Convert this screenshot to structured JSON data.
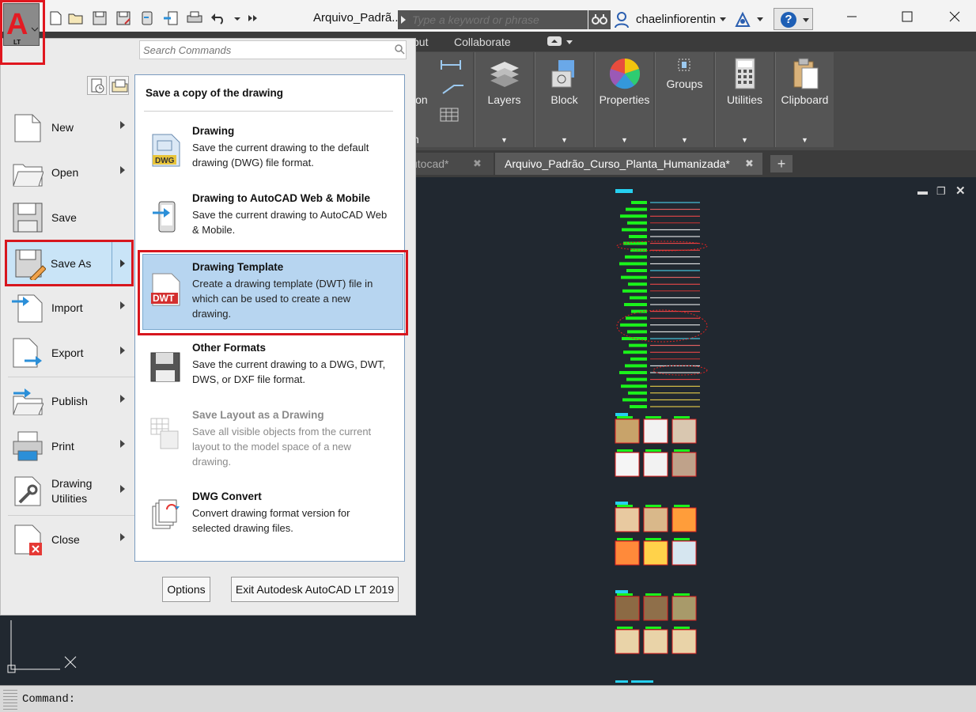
{
  "window": {
    "title": "Arquivo_Padrã...",
    "search_placeholder": "Type a keyword or phrase",
    "user": "chaelinfiorentin",
    "help": "?"
  },
  "app_button": {
    "label": "LT"
  },
  "ribbon": {
    "tabs": [
      "put",
      "Collaborate"
    ],
    "panels": [
      "Layers",
      "Block",
      "Properties",
      "Groups",
      "Utilities",
      "Clipboard"
    ],
    "partial_labels": [
      "ion",
      "n"
    ]
  },
  "doc_tabs": [
    {
      "label": "utocad*"
    },
    {
      "label": "Arquivo_Padrão_Curso_Planta_Humanizada*"
    }
  ],
  "app_menu": {
    "search_placeholder": "Search Commands",
    "items": [
      {
        "label": "New",
        "arrow": true,
        "icon": "new-file-icon"
      },
      {
        "label": "Open",
        "arrow": true,
        "icon": "open-folder-icon"
      },
      {
        "label": "Save",
        "arrow": false,
        "icon": "save-disk-icon"
      },
      {
        "label": "Save As",
        "arrow": true,
        "icon": "save-as-icon"
      },
      {
        "label": "Import",
        "arrow": true,
        "icon": "import-icon"
      },
      {
        "label": "Export",
        "arrow": true,
        "icon": "export-icon"
      },
      {
        "label": "Publish",
        "arrow": true,
        "icon": "publish-icon"
      },
      {
        "label": "Print",
        "arrow": true,
        "icon": "printer-icon"
      },
      {
        "label": "Drawing\nUtilities",
        "arrow": true,
        "icon": "wrench-icon"
      },
      {
        "label": "Close",
        "arrow": true,
        "icon": "close-file-icon"
      }
    ],
    "submenu": {
      "header": "Save a copy of the drawing",
      "items": [
        {
          "title": "Drawing",
          "desc": "Save the current drawing to the default drawing (DWG) file format.",
          "icon": "dwg-file-icon",
          "badge": "DWG"
        },
        {
          "title": "Drawing to AutoCAD Web & Mobile",
          "desc": "Save the current drawing to AutoCAD Web & Mobile.",
          "icon": "mobile-device-icon"
        },
        {
          "title": "Drawing Template",
          "desc": "Create a drawing template (DWT) file in which can be used to create a new drawing.",
          "icon": "dwt-file-icon",
          "badge": "DWT"
        },
        {
          "title": "Other Formats",
          "desc": "Save the current drawing to a DWG, DWT, DWS, or DXF file format.",
          "icon": "floppy-disk-icon"
        },
        {
          "title": "Save Layout as a Drawing",
          "desc": "Save all visible objects from the current layout to the model space of a new drawing.",
          "icon": "layout-icon"
        },
        {
          "title": "DWG Convert",
          "desc": "Convert drawing format version for selected drawing files.",
          "icon": "dwg-convert-icon"
        }
      ]
    },
    "options_label": "Options",
    "exit_label": "Exit Autodesk AutoCAD LT 2019"
  },
  "command_line": {
    "prompt": "Command:"
  }
}
